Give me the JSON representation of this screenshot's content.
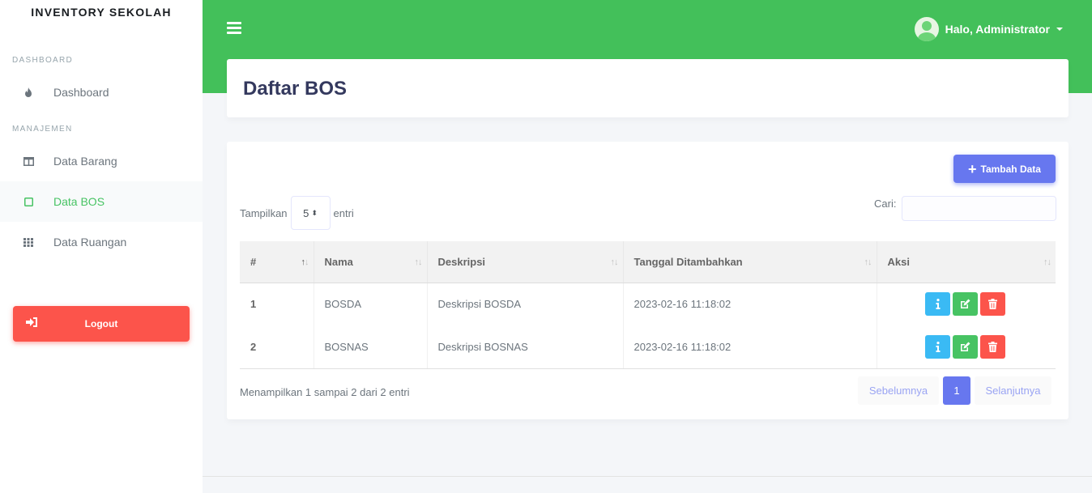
{
  "sidebar": {
    "brand": "INVENTORY SEKOLAH",
    "header_dashboard": "DASHBOARD",
    "header_manajemen": "MANAJEMEN",
    "items": [
      {
        "label": "Dashboard",
        "icon": "fire-icon"
      },
      {
        "label": "Data Barang",
        "icon": "columns-icon"
      },
      {
        "label": "Data BOS",
        "icon": "square-icon",
        "active": true
      },
      {
        "label": "Data Ruangan",
        "icon": "grid-icon"
      }
    ],
    "logout_label": "Logout"
  },
  "topbar": {
    "user_greeting": "Halo, Administrator"
  },
  "page": {
    "title": "Daftar BOS"
  },
  "card": {
    "add_button": "Tambah Data",
    "length_prefix": "Tampilkan",
    "length_value": "5",
    "length_suffix": "entri",
    "search_label": "Cari:",
    "search_value": "",
    "columns": [
      "#",
      "Nama",
      "Deskripsi",
      "Tanggal Ditambahkan",
      "Aksi"
    ],
    "rows": [
      {
        "no": "1",
        "nama": "BOSDA",
        "deskripsi": "Deskripsi BOSDA",
        "tanggal": "2023-02-16 11:18:02"
      },
      {
        "no": "2",
        "nama": "BOSNAS",
        "deskripsi": "Deskripsi BOSNAS",
        "tanggal": "2023-02-16 11:18:02"
      }
    ],
    "info": "Menampilkan 1 sampai 2 dari 2 entri",
    "pager": {
      "prev": "Sebelumnya",
      "current": "1",
      "next": "Selanjutnya"
    }
  },
  "colors": {
    "green": "#43c05a",
    "primary": "#6777ef",
    "danger": "#fc544b",
    "info": "#3abaf4",
    "success": "#47c363"
  }
}
